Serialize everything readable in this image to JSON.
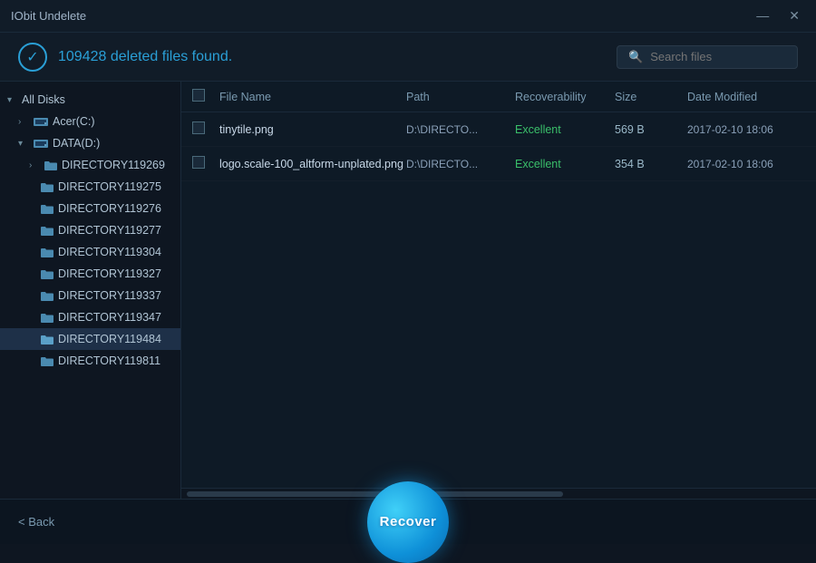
{
  "app": {
    "title": "IObit Undelete"
  },
  "title_bar": {
    "minimize_label": "—",
    "close_label": "✕"
  },
  "header": {
    "status_text": "109428 deleted files found.",
    "search_placeholder": "Search files"
  },
  "sidebar": {
    "all_disks_label": "All Disks",
    "acer_label": "Acer(C:)",
    "data_label": "DATA(D:)",
    "folders": [
      "DIRECTORY119269",
      "DIRECTORY119275",
      "DIRECTORY119276",
      "DIRECTORY119277",
      "DIRECTORY119304",
      "DIRECTORY119327",
      "DIRECTORY119337",
      "DIRECTORY119347",
      "DIRECTORY119484",
      "DIRECTORY119811"
    ]
  },
  "table": {
    "columns": {
      "name": "File Name",
      "path": "Path",
      "recoverability": "Recoverability",
      "size": "Size",
      "date_modified": "Date Modified"
    },
    "rows": [
      {
        "name": "tinytile.png",
        "path": "D:\\DIRECTO...",
        "recoverability": "Excellent",
        "size": "569 B",
        "date_modified": "2017-02-10 18:06"
      },
      {
        "name": "logo.scale-100_altform-unplated.png",
        "path": "D:\\DIRECTO...",
        "recoverability": "Excellent",
        "size": "354 B",
        "date_modified": "2017-02-10 18:06"
      }
    ]
  },
  "footer": {
    "back_label": "< Back",
    "recover_label": "Recover"
  }
}
